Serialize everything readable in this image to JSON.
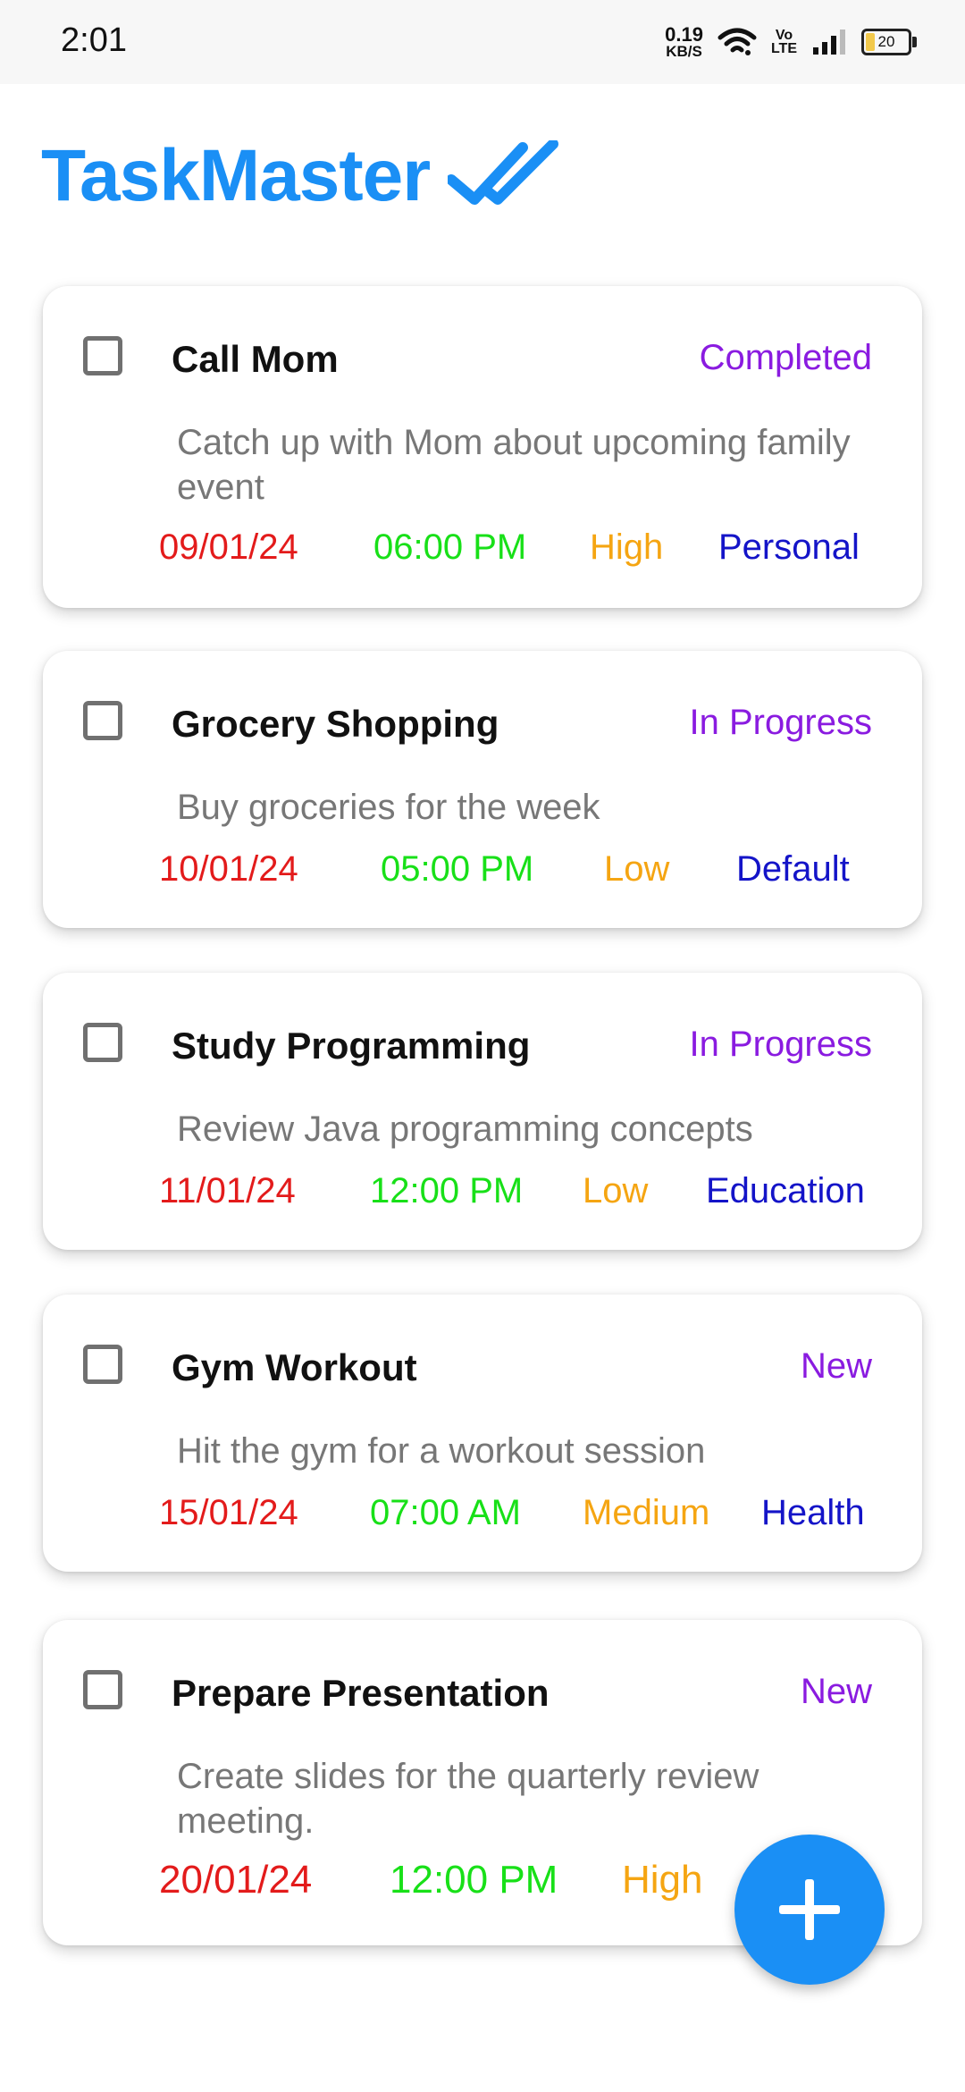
{
  "status_bar": {
    "time": "2:01",
    "net_speed_value": "0.19",
    "net_speed_unit": "KB/S",
    "volte_top": "Vo",
    "volte_bottom": "LTE",
    "battery": "20"
  },
  "header": {
    "title": "TaskMaster",
    "icon": "double-check-icon"
  },
  "colors": {
    "accent": "#1a8ff5",
    "status": "#8a1be0",
    "date": "#e31b1b",
    "time": "#18e018",
    "priority": "#f5a512",
    "category": "#1414c8"
  },
  "tasks": [
    {
      "title": "Call Mom",
      "status": "Completed",
      "description": "Catch up with Mom about upcoming family event",
      "date": "09/01/24",
      "time": "06:00 PM",
      "priority": "High",
      "category": "Personal"
    },
    {
      "title": "Grocery Shopping",
      "status": "In Progress",
      "description": "Buy groceries for the week",
      "date": "10/01/24",
      "time": "05:00 PM",
      "priority": "Low",
      "category": "Default"
    },
    {
      "title": "Study Programming",
      "status": "In Progress",
      "description": "Review Java programming concepts",
      "date": "11/01/24",
      "time": "12:00 PM",
      "priority": "Low",
      "category": "Education"
    },
    {
      "title": "Gym Workout",
      "status": "New",
      "description": "Hit the gym for a workout session",
      "date": "15/01/24",
      "time": "07:00 AM",
      "priority": "Medium",
      "category": "Health"
    },
    {
      "title": "Prepare Presentation",
      "status": "New",
      "description": "Create slides for the quarterly review meeting.",
      "date": "20/01/24",
      "time": "12:00 PM",
      "priority": "High",
      "category": ""
    }
  ],
  "fab": {
    "icon": "plus-icon"
  }
}
